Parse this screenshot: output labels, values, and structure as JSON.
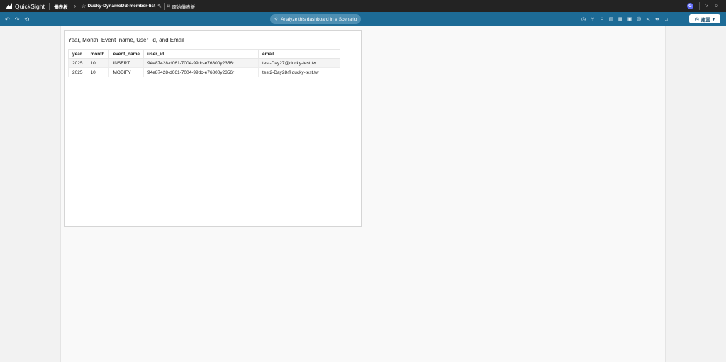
{
  "topbar": {
    "app_name": "QuickSight",
    "breadcrumb_root": "儀表板",
    "dashboard_name": "Ducky-DynamoDB-member-list",
    "original_label": "原始儀表板",
    "avatar_letter": "G"
  },
  "toolbar": {
    "scenario_label": "Analyze this dashboard in a Scenario",
    "share_label": "建置"
  },
  "visual": {
    "title": "Year, Month, Event_name, User_id, and Email",
    "columns": [
      "year",
      "month",
      "event_name",
      "user_id",
      "email"
    ],
    "rows": [
      [
        "2025",
        "10",
        "INSERT",
        "94e87428-d061-7004-99dc-e76800y2356r",
        "test-Day27@ducky-test.tw"
      ],
      [
        "2025",
        "10",
        "MODIFY",
        "94e87428-d061-7004-99dc-e76800y2356r",
        "test2-Day28@ducky-test.tw"
      ]
    ]
  },
  "colors": {
    "topbar": "#232323",
    "toolbar": "#1d6b96",
    "canvas": "#f9f9f9"
  }
}
